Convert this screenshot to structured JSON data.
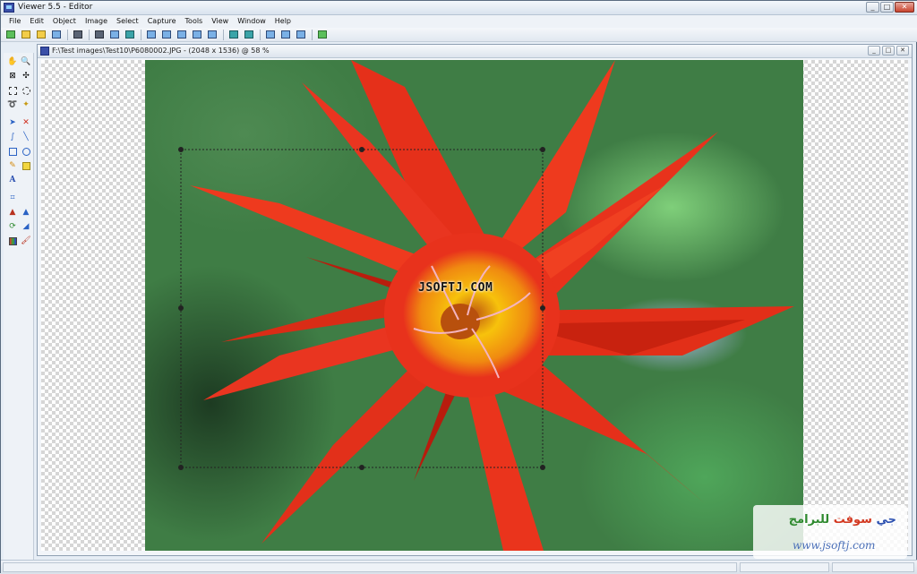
{
  "window": {
    "title": "Viewer 5.5 - Editor",
    "controls": [
      "_",
      "□",
      "✕"
    ]
  },
  "menu": [
    "File",
    "Edit",
    "Object",
    "Image",
    "Select",
    "Capture",
    "Tools",
    "View",
    "Window",
    "Help"
  ],
  "toolbar": {
    "groups": [
      [
        "new-icon",
        "open-icon",
        "open-folder-icon",
        "save-icon"
      ],
      [
        "print-icon"
      ],
      [
        "cut-icon",
        "copy-icon",
        "paste-icon"
      ],
      [
        "monitor-icon",
        "monitor-icon-2",
        "monitor-icon-3",
        "monitor-icon-4",
        "monitor-icon-5"
      ],
      [
        "crop-icon",
        "resize-arrows-icon"
      ],
      [
        "cascade-icon",
        "tile-horizontal-icon",
        "tile-vertical-icon"
      ],
      [
        "help-icon"
      ]
    ]
  },
  "document": {
    "title": "F:\\Test images\\Test10\\P6080002.JPG - (2048 x 1536) @ 58 %",
    "controls": [
      "_",
      "□",
      "✕"
    ]
  },
  "image": {
    "overlay_text": "JSOFTJ.COM"
  },
  "watermark": {
    "arabic_part1": "جي",
    "arabic_part2": "سوفت",
    "arabic_part3": "للبرامج",
    "url": "www.jsoftj.com"
  },
  "colors": {
    "petal": "#e8321c",
    "petal_dark": "#b91d0d",
    "center": "#f5c40c",
    "leaf": "#3f7d45"
  }
}
